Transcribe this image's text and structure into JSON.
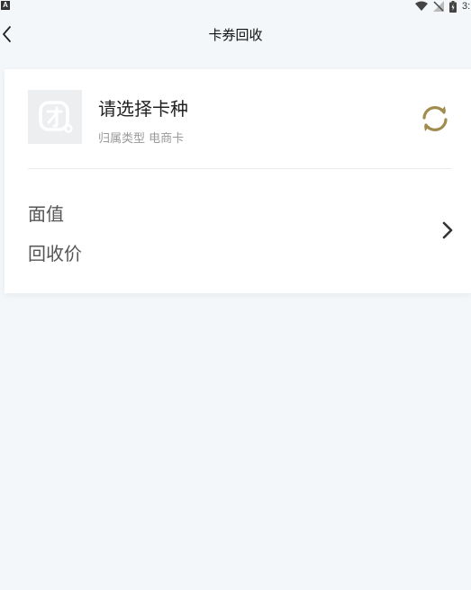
{
  "status_bar": {
    "app_icon_letter": "A",
    "time": "3:"
  },
  "header": {
    "title": "卡券回收"
  },
  "card_type": {
    "title": "请选择卡种",
    "subtitle": "归属类型 电商卡"
  },
  "details": {
    "face_value_label": "面值",
    "recycle_price_label": "回收价"
  },
  "colors": {
    "background": "#f3f7f9",
    "card": "#ffffff",
    "refresh_accent": "#a08c4f",
    "logo_placeholder": "#eceef0"
  },
  "icons": {
    "back": "back-arrow-icon",
    "refresh": "refresh-icon",
    "chevron": "chevron-right-icon",
    "logo": "card-logo-icon"
  }
}
